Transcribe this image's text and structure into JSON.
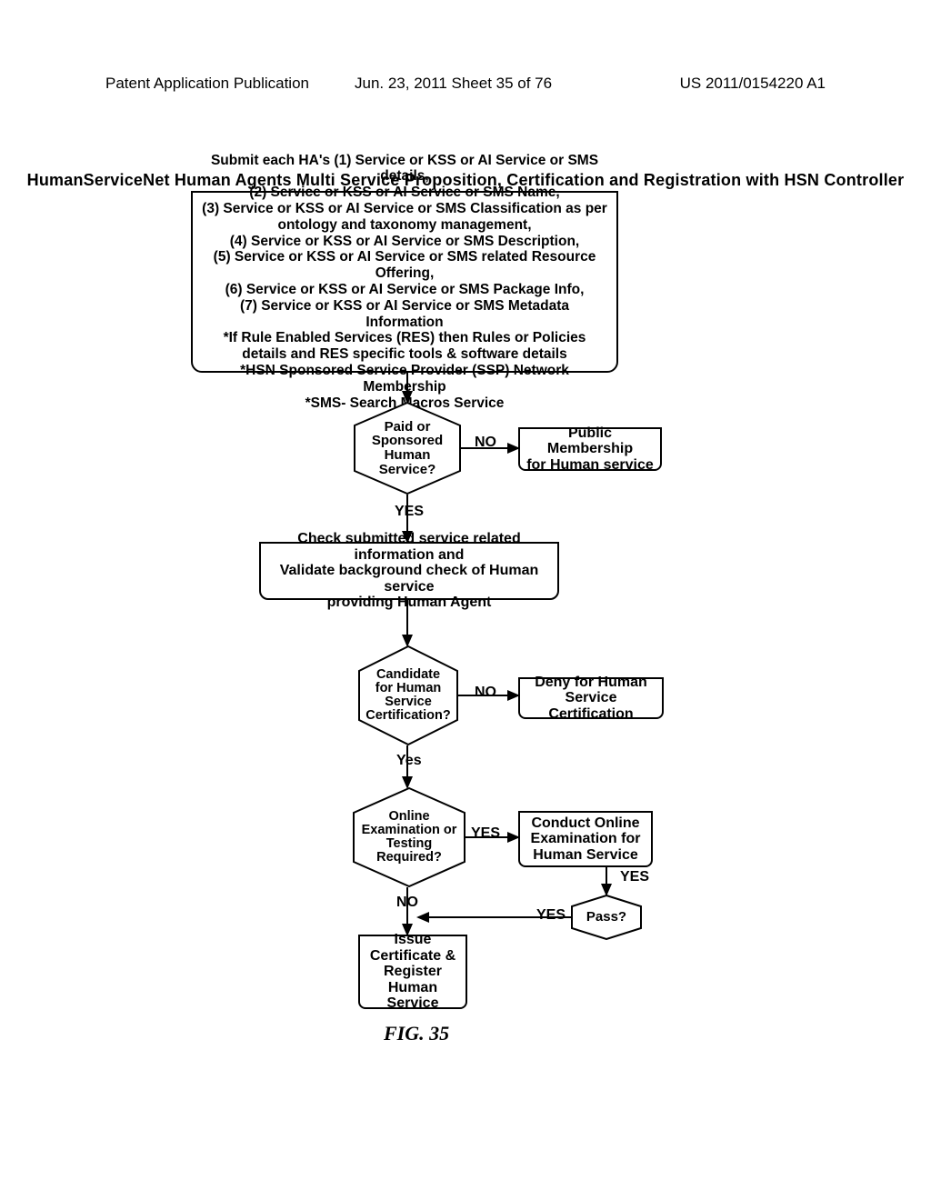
{
  "header": {
    "left": "Patent Application Publication",
    "mid": "Jun. 23, 2011  Sheet 35 of 76",
    "right": "US 2011/0154220 A1"
  },
  "title": "HumanServiceNet Human Agents Multi Service Proposition, Certification and Registration with HSN Controller",
  "submit_box": "Submit each HA's (1) Service or KSS or AI Service or SMS details,\n(2) Service or KSS or AI Service or SMS Name,\n(3) Service or KSS or AI Service or SMS Classification as per ontology and taxonomy management,\n(4) Service or KSS or AI Service or SMS Description,\n(5) Service or KSS or AI Service or SMS related Resource Offering,\n(6) Service or KSS or AI Service or SMS Package Info,\n(7) Service or KSS or AI Service or SMS Metadata Information\n*If Rule Enabled Services (RES) then Rules or Policies details and RES specific tools & software details\n*HSN Sponsored Service Provider (SSP) Network Membership\n*SMS- Search Macros Service",
  "dec_paid": "Paid or\nSponsored\nHuman Service?",
  "box_public": "Public Membership\nfor Human service",
  "box_check": "Check submitted service related information and\nValidate background check of Human service\nproviding Human Agent",
  "dec_candidate": "Candidate\nfor Human\nService\nCertification?",
  "box_deny": "Deny for Human\nService Certification",
  "dec_exam": "Online\nExamination or\nTesting\nRequired?",
  "box_conduct": "Conduct Online\nExamination for\nHuman Service",
  "dec_pass": "Pass?",
  "box_issue": "Issue\nCertificate &\nRegister Human\nService",
  "labels": {
    "no1": "NO",
    "yes1": "YES",
    "no2": "NO",
    "yes2": "Yes",
    "yes3": "YES",
    "no3": "NO",
    "yes4": "YES",
    "yes5": "YES"
  },
  "figure": "FIG. 35"
}
